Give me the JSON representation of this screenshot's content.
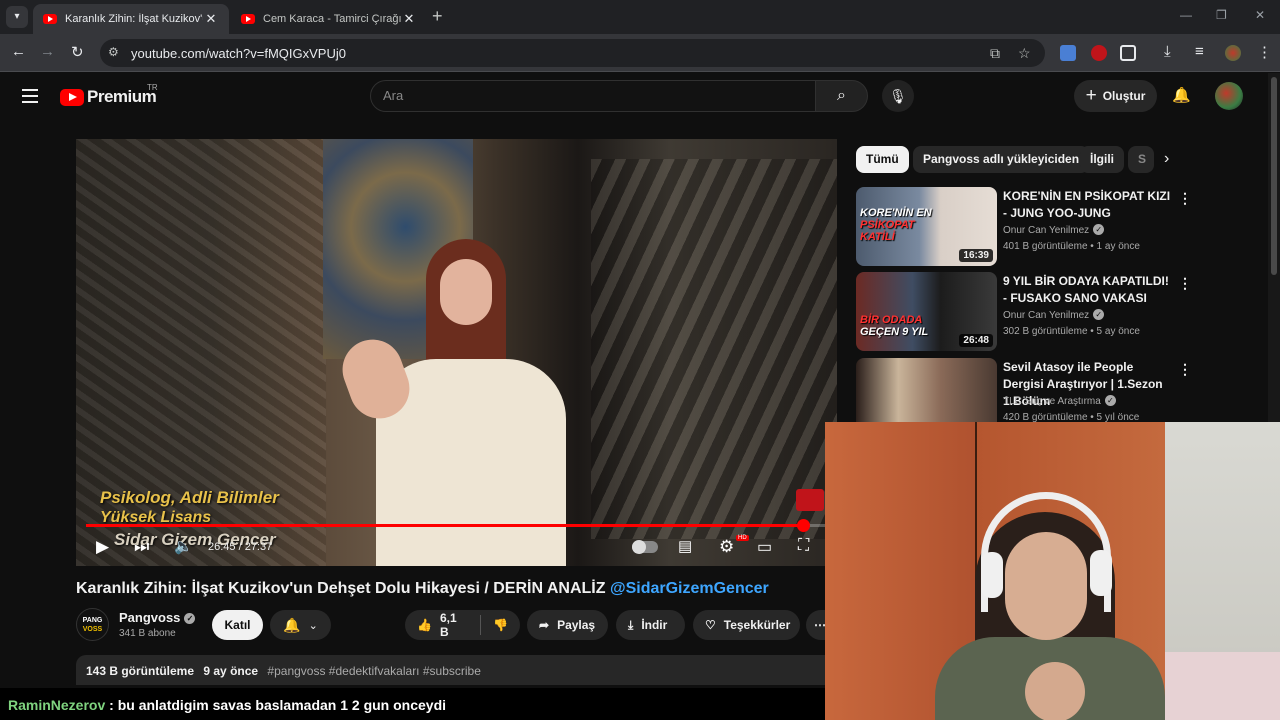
{
  "browser": {
    "tabs": [
      {
        "title": "Karanlık Zihin: İlşat Kuzikov'un De",
        "active": true
      },
      {
        "title": "Cem Karaca - Tamirci Çırağı (Offi",
        "active": false
      }
    ],
    "url": "youtube.com/watch?v=fMQIGxVPUj0"
  },
  "youtube": {
    "logo_text": "Premium",
    "logo_region": "TR",
    "search_placeholder": "Ara",
    "create_label": "Oluştur"
  },
  "video": {
    "caption_line1": "Psikolog, Adli Bilimler",
    "caption_line2": "Yüksek Lisans",
    "caption_line3": "Sidar Gizem Gencer",
    "time": "26:45 / 27:37",
    "progress_fraction": 0.969,
    "title": "Karanlık Zihin: İlşat Kuzikov'un Dehşet Dolu Hikayesi / DERİN ANALİZ ",
    "title_mention": "@SidarGizemGencer"
  },
  "channel": {
    "avatar_line1": "PANG",
    "avatar_line2": "VOSS",
    "name": "Pangvoss",
    "subscribers": "341 B abone",
    "join_label": "Katıl"
  },
  "actions": {
    "likes": "6,1 B",
    "share": "Paylaş",
    "download": "İndir",
    "thanks": "Teşekkürler",
    "more": "⋯"
  },
  "description": {
    "views": "143 B görüntüleme",
    "age": "9 ay önce",
    "tags": "#pangvoss #dedektifvakaları #subscribe"
  },
  "chips": [
    "Tümü",
    "Pangvoss adlı yükleyiciden",
    "İlgili",
    "S"
  ],
  "recommendations": [
    {
      "thumb_line1": "KORE'NİN EN",
      "thumb_line2": "PSİKOPAT",
      "thumb_line3": "KATİLİ",
      "duration": "16:39",
      "title": "KORE'NİN EN PSİKOPAT KIZI - JUNG YOO-JUNG",
      "channel": "Onur Can Yenilmez",
      "meta": "401 B görüntüleme • 1 ay önce"
    },
    {
      "thumb_line1": "BİR ODADA",
      "thumb_line2": "GEÇEN 9 YIL",
      "duration": "26:48",
      "title": "9 YIL BİR ODAYA KAPATILDI! - FUSAKO SANO VAKASI",
      "channel": "Onur Can Yenilmez",
      "meta": "302 B görüntüleme • 5 ay önce"
    },
    {
      "title": "Sevil Atasoy ile People Dergisi Araştırıyor | 1.Sezon 1.Bölüm",
      "channel": "TLC Suç ve Araştırma",
      "meta": "420 B görüntüleme • 5 yıl önce"
    }
  ],
  "chat": {
    "user": "RaminNezerov",
    "message": " : bu anlatdigim savas baslamadan 1 2 gun onceydi"
  }
}
